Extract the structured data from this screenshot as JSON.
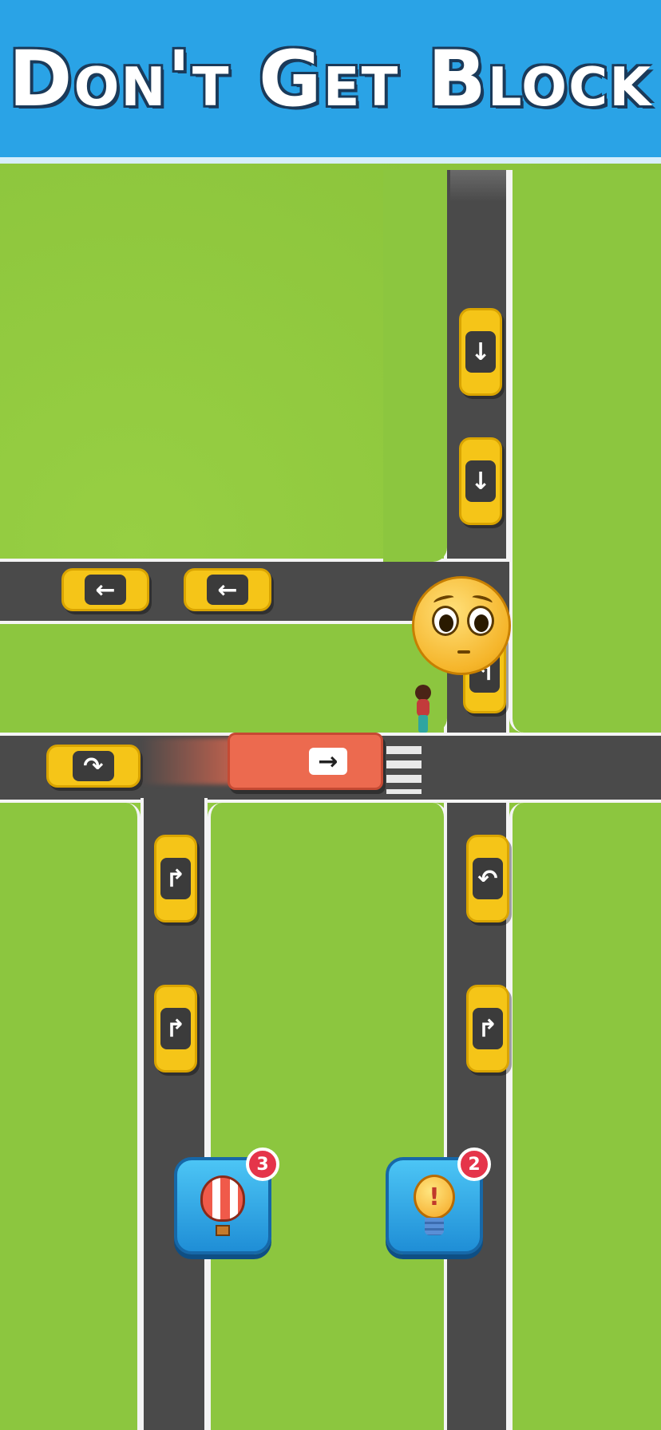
{
  "banner": {
    "title": "Don't Get Block"
  },
  "cars": {
    "top1": {
      "arrow": "↓",
      "icon": "arrow-down-icon"
    },
    "top2": {
      "arrow": "↓",
      "icon": "arrow-down-icon"
    },
    "left1": {
      "arrow": "←",
      "icon": "arrow-left-icon"
    },
    "left2": {
      "arrow": "←",
      "icon": "arrow-left-icon"
    },
    "mid": {
      "arrow": "↰",
      "icon": "turn-arrow-icon"
    },
    "lower_left": {
      "arrow": "↷",
      "icon": "turn-right-arrow-icon"
    },
    "col1a": {
      "arrow": "↱",
      "icon": "turn-right-arrow-icon"
    },
    "col1b": {
      "arrow": "↱",
      "icon": "turn-right-arrow-icon"
    },
    "col2a": {
      "arrow": "↶",
      "icon": "u-turn-arrow-icon"
    },
    "col2b": {
      "arrow": "↱",
      "icon": "turn-right-arrow-icon"
    }
  },
  "bus": {
    "arrow": "→",
    "icon": "arrow-right-icon"
  },
  "emoji": {
    "icon": "pleading-face-icon"
  },
  "powerups": {
    "balloon": {
      "count": "3",
      "icon": "hot-air-balloon-icon"
    },
    "hint": {
      "count": "2",
      "icon": "lightbulb-hint-icon"
    }
  },
  "colors": {
    "sky": "#2aa3e6",
    "grass": "#8cc63f",
    "road": "#4a4a4a",
    "taxi": "#f5c518",
    "bus": "#ec6a4f",
    "badge": "#e5344a"
  }
}
